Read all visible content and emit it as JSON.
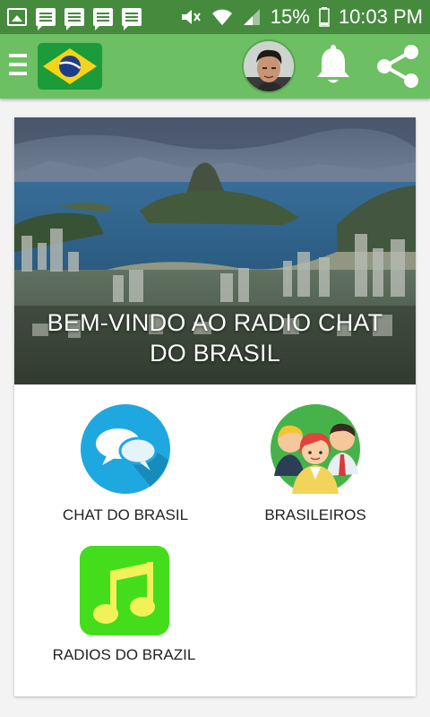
{
  "status_bar": {
    "battery": "15%",
    "time": "10:03 PM"
  },
  "app_bar": {
    "menu_icon": "hamburger-icon",
    "flag_icon": "brazil-flag-icon",
    "notification_icon": "bell-icon",
    "share_icon": "share-icon"
  },
  "hero": {
    "title_line1": "BEM-VINDO AO RADIO CHAT",
    "title_line2": "DO BRASIL"
  },
  "features": {
    "chat": {
      "label": "CHAT DO BRASIL",
      "icon": "chat-bubbles-icon"
    },
    "brasileiros": {
      "label": "BRASILEIROS",
      "icon": "people-group-icon"
    },
    "radios": {
      "label": "RADIOS DO BRAZIL",
      "icon": "music-note-icon"
    }
  },
  "colors": {
    "status_bar": "#468a3e",
    "app_bar": "#6cbf62",
    "chat_icon_bg": "#1fa8e0",
    "radio_icon_bg": "#44dd1c",
    "people_icon_bg": "#46b34a"
  }
}
